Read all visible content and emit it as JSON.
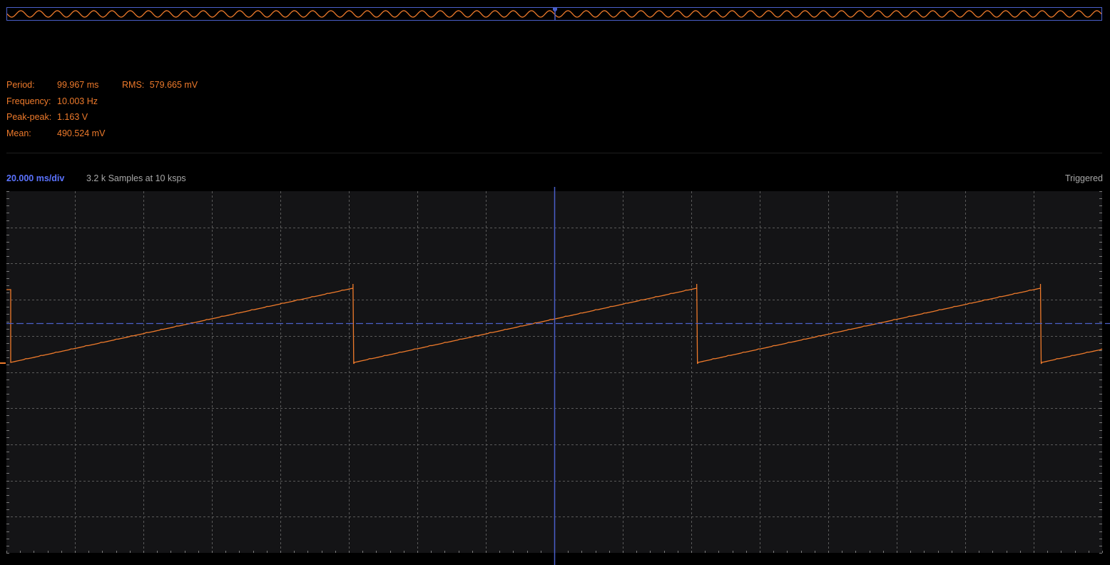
{
  "measurements": {
    "period_label": "Period:",
    "period_value": "99.967 ms",
    "rms_label": "RMS:",
    "rms_value": "579.665 mV",
    "frequency_label": "Frequency:",
    "frequency_value": "10.003 Hz",
    "peakpeak_label": "Peak-peak:",
    "peakpeak_value": "1.163 V",
    "mean_label": "Mean:",
    "mean_value": "490.524 mV"
  },
  "status": {
    "timebase": "20.000 ms/div",
    "samples": "3.2 k Samples at 10 ksps",
    "trigger_state": "Triggered"
  },
  "colors": {
    "trace": "#ee7a2b",
    "cursor": "#4a5fc9",
    "grid": "#5a5a5a",
    "plot_bg": "#141416"
  },
  "waveform": {
    "type": "sawtooth",
    "frequency_hz": 10.003,
    "period_ms": 99.967,
    "timebase_ms_per_div": 20,
    "horizontal_divisions": 16,
    "vertical_divisions": 10,
    "trigger_position": "center",
    "overview_cycles": 60
  }
}
